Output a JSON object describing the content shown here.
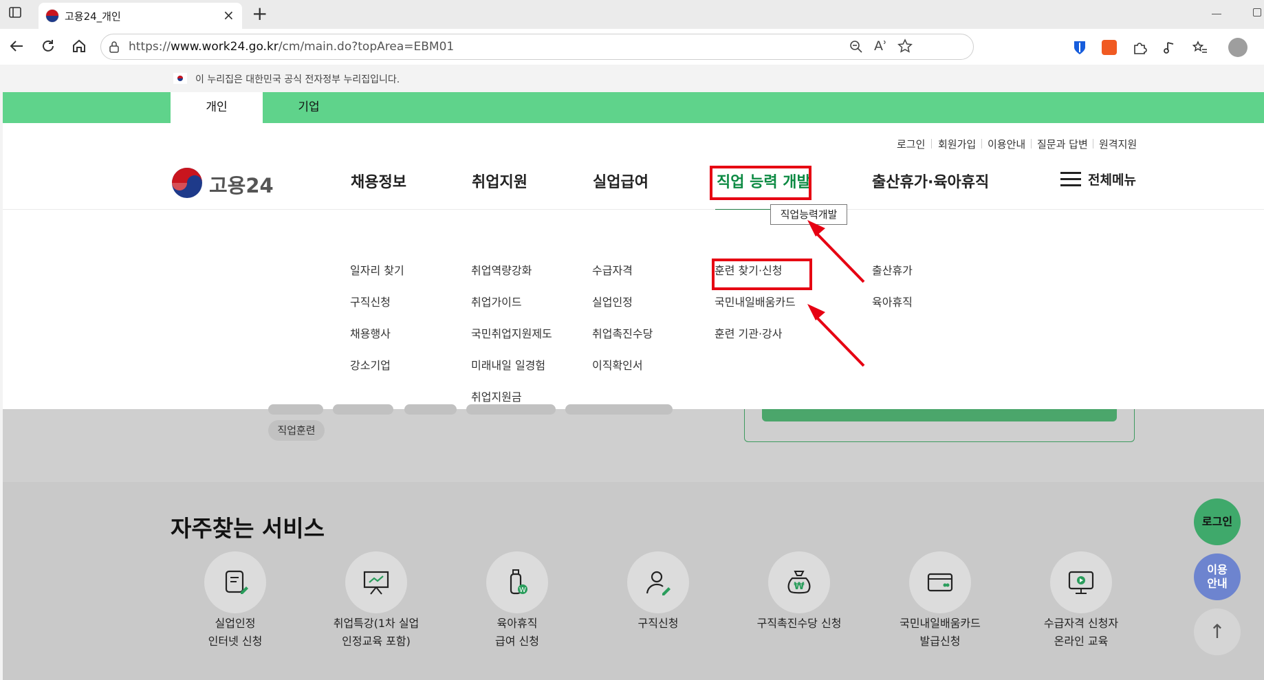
{
  "browser": {
    "tab_title": "고용24_개인",
    "url_prefix": "https://",
    "url_domain": "www.work24.go.kr",
    "url_path": "/cm/main.do?topArea=EBM01",
    "close_glyph": "×",
    "new_tab_glyph": "+",
    "reader_glyph": "Aʾ"
  },
  "gov_banner": {
    "text": "이 누리집은 대한민국 공식 전자정부 누리집입니다."
  },
  "top_tabs": {
    "individual": "개인",
    "company": "기업"
  },
  "utility_links": [
    "로그인",
    "회원가입",
    "이용안내",
    "질문과 답변",
    "원격지원"
  ],
  "logo": {
    "text": "고용24"
  },
  "gnb": {
    "items": [
      "채용정보",
      "취업지원",
      "실업급여",
      "직업 능력 개발",
      "출산휴가·육아휴직"
    ],
    "all_menu": "전체메뉴",
    "tooltip": "직업능력개발"
  },
  "submenu": {
    "col1": [
      "일자리 찾기",
      "구직신청",
      "채용행사",
      "강소기업"
    ],
    "col2": [
      "취업역량강화",
      "취업가이드",
      "국민취업지원제도",
      "미래내일 일경험",
      "취업지원금"
    ],
    "col3": [
      "수급자격",
      "실업인정",
      "취업촉진수당",
      "이직확인서"
    ],
    "col4": [
      "훈련 찾기·신청",
      "국민내일배움카드",
      "훈련 기관·강사"
    ],
    "col5": [
      "출산휴가",
      "육아휴직"
    ]
  },
  "dim": {
    "chip_label": "직업훈련"
  },
  "faq": {
    "title": "자주찾는 서비스",
    "services": [
      {
        "line1": "실업인정",
        "line2": "인터넷 신청",
        "icon": "document-pen-icon"
      },
      {
        "line1": "취업특강(1차 실업",
        "line2": "인정교육 포함)",
        "icon": "presentation-board-icon"
      },
      {
        "line1": "육아휴직",
        "line2": "급여 신청",
        "icon": "baby-bottle-won-icon"
      },
      {
        "line1": "구직신청",
        "line2": "",
        "icon": "person-pen-icon"
      },
      {
        "line1": "구직촉진수당 신청",
        "line2": "",
        "icon": "money-bag-won-icon"
      },
      {
        "line1": "국민내일배움카드",
        "line2": "발급신청",
        "icon": "card-icon"
      },
      {
        "line1": "수급자격 신청자",
        "line2": "온라인 교육",
        "icon": "monitor-play-icon"
      }
    ]
  },
  "floating": {
    "login": "로그인",
    "guide_line1": "이용",
    "guide_line2": "안내",
    "top": "↑"
  },
  "colors": {
    "brand_green": "#5fd38b",
    "highlight_red": "#e60012",
    "active_green": "#0c8a43"
  }
}
